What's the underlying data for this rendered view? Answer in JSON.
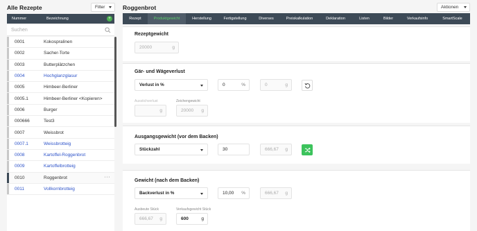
{
  "left": {
    "title": "Alle Rezepte",
    "filter_label": "Filter",
    "col_number": "Nummer",
    "col_name": "Bezeichnung",
    "add_icon": "plus-icon",
    "search_placeholder": "Suchen",
    "rows": [
      {
        "num": "0001",
        "name": "Kokospralinen"
      },
      {
        "num": "0002",
        "name": "Sacher-Torte"
      },
      {
        "num": "0003",
        "name": "Butterplätzchen"
      },
      {
        "num": "0004",
        "name": "Hochglanzglasur"
      },
      {
        "num": "0005",
        "name": "Himbeer-Berliner"
      },
      {
        "num": "0005.1",
        "name": "Himbeer-Berliner <Kopieren>"
      },
      {
        "num": "0006",
        "name": "Burger"
      },
      {
        "num": "000666",
        "name": "Test3"
      },
      {
        "num": "0007",
        "name": "Weissbrot"
      },
      {
        "num": "0007.1",
        "name": "Weissbrotteig"
      },
      {
        "num": "0008",
        "name": "Kartoffel-Roggenbrot"
      },
      {
        "num": "0009",
        "name": "Kartoffelbrotteig"
      },
      {
        "num": "0010",
        "name": "Roggenbrot",
        "more": "···"
      },
      {
        "num": "0011",
        "name": "Vollkornbrotteig"
      }
    ],
    "colors": {
      "link": "#2c52c9",
      "header": "#3d4a57"
    }
  },
  "right": {
    "title": "Roggenbrot",
    "actions_label": "Aktionen",
    "tabs": [
      "Rezept",
      "Produktgewicht",
      "Herstellung",
      "Fertigstellung",
      "Diverses",
      "Preiskalkulation",
      "Deklaration",
      "Listen",
      "Bilder",
      "Verkaufsinfo",
      "SmartScale"
    ],
    "active_tab": "Produktgewicht",
    "accent": "#5dcf6b",
    "rezeptgewicht": {
      "heading": "Rezeptgewicht",
      "value": "20000",
      "unit": "g"
    },
    "gaer": {
      "heading": "Gär- und Wägeverlust",
      "select": "Verlust in %",
      "percent_value": "0",
      "percent_unit": "%",
      "gram_value": "0",
      "gram_unit": "g",
      "reset_icon": "reset-icon",
      "label_ausstich": "Ausstichverlust",
      "ausstich_unit": "g",
      "label_zeichen": "Zeichengewicht",
      "zeichen_value": "20000",
      "zeichen_unit": "g"
    },
    "ausgang": {
      "heading": "Ausgangsgewicht (vor dem Backen)",
      "select": "Stückzahl",
      "count": "30",
      "weight": "666,67",
      "unit": "g",
      "swap_icon": "shuffle-icon"
    },
    "gewicht": {
      "heading": "Gewicht (nach dem Backen)",
      "select": "Backverlust in %",
      "percent_value": "10,00",
      "percent_unit": "%",
      "weight": "666,67",
      "unit": "g",
      "label_ausbeute": "Ausbeute Stück",
      "ausbeute_value": "666,67",
      "ausbeute_unit": "g",
      "label_verkauf": "Verkaufsgewicht Stück",
      "verkauf_value": "600",
      "verkauf_unit": "g"
    }
  }
}
